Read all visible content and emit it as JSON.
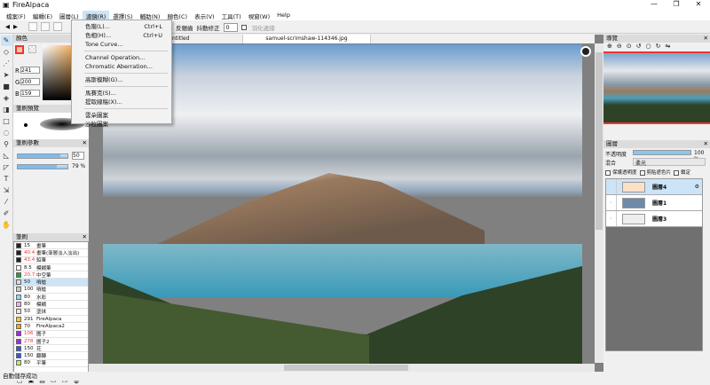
{
  "app": {
    "title": "FireAlpaca",
    "minimize": "—",
    "maximize": "❐",
    "close": "✕"
  },
  "menubar": [
    "檔案(F)",
    "編輯(E)",
    "圖層(L)",
    "濾鏡(R)",
    "選擇(S)",
    "輔助(N)",
    "顏色(C)",
    "表示(V)",
    "工具(T)",
    "視窗(W)",
    "Help"
  ],
  "toolbar": {
    "antialias": "反鋸齒",
    "stabilizer_label": "抖動修正",
    "stabilizer_value": "0",
    "feather": "羽化邊緣"
  },
  "filter_menu": {
    "items": [
      {
        "label": "色階(L)...",
        "shortcut": "Ctrl+L"
      },
      {
        "label": "色相(H)...",
        "shortcut": "Ctrl+U"
      },
      {
        "label": "Tone Curve...",
        "shortcut": ""
      },
      {
        "label": "Channel Operation...",
        "shortcut": ""
      },
      {
        "label": "Chromatic Aberration...",
        "shortcut": ""
      },
      {
        "label": "高斯模糊(G)...",
        "shortcut": ""
      },
      {
        "label": "馬賽克(S)...",
        "shortcut": ""
      },
      {
        "label": "提取線稿(X)...",
        "shortcut": ""
      },
      {
        "label": "雲朵圖案",
        "shortcut": ""
      },
      {
        "label": "沙粒圖案",
        "shortcut": ""
      }
    ]
  },
  "color_panel": {
    "title": "顏色",
    "r_label": "R",
    "r": "241",
    "g_label": "G",
    "g": "200",
    "b_label": "B",
    "b": "159",
    "fg": "#f1c89f"
  },
  "brush_preview": {
    "title": "筆刷預覽"
  },
  "brush_params": {
    "title": "筆刷參數",
    "size": "50",
    "opacity": "79 %",
    "size_fraction": 0.85,
    "opacity_fraction": 0.79
  },
  "brushes": {
    "title": "筆刷",
    "items": [
      {
        "size": "15",
        "name": "畫筆",
        "color": "#222222",
        "red": false
      },
      {
        "size": "40.4",
        "name": "畫筆(漸層淡入淡出)",
        "color": "#222222",
        "red": true
      },
      {
        "size": "43.4",
        "name": "鉛筆",
        "color": "#222222",
        "red": true
      },
      {
        "size": "8.5",
        "name": "模糊筆",
        "color": "#ffffff",
        "red": false
      },
      {
        "size": "20.7",
        "name": "中空筆",
        "color": "#22aa22",
        "red": true
      },
      {
        "size": "50",
        "name": "噴槍",
        "color": "#dddddd",
        "red": false,
        "selected": true
      },
      {
        "size": "100",
        "name": "噴槍",
        "color": "#cccccc",
        "red": false
      },
      {
        "size": "80",
        "name": "水彩",
        "color": "#88ddff",
        "red": false
      },
      {
        "size": "80",
        "name": "模糊",
        "color": "#ffaaee",
        "red": false
      },
      {
        "size": "50",
        "name": "塗抹",
        "color": "#ffe0c8",
        "red": false
      },
      {
        "size": "291",
        "name": "FireAlpaca",
        "color": "#eecc22",
        "red": false
      },
      {
        "size": "70",
        "name": "FireAlpaca2",
        "color": "#ffaa00",
        "red": false
      },
      {
        "size": "106",
        "name": "圖子",
        "color": "#aa22ee",
        "red": true
      },
      {
        "size": "278",
        "name": "圖子2",
        "color": "#aa22ee",
        "red": true
      },
      {
        "size": "150",
        "name": "花",
        "color": "#3355ee",
        "red": false
      },
      {
        "size": "150",
        "name": "翻轉",
        "color": "#3355ee",
        "red": false
      },
      {
        "size": "80",
        "name": "平筆",
        "color": "#bbee66",
        "red": false
      }
    ]
  },
  "tabs": [
    {
      "label": "Untitled",
      "active": false
    },
    {
      "label": "samuel-scrimshaw-114346.jpg",
      "active": true
    }
  ],
  "navigator": {
    "title": "導覽"
  },
  "layers": {
    "title": "圖層",
    "opacity_label": "不透明度",
    "opacity": "100 %",
    "blend_label": "混合",
    "blend": "柔光",
    "protect": "保護透明度",
    "clip": "剪貼遮色片",
    "lock": "鎖定",
    "items": [
      {
        "name": "圖層4",
        "selected": true,
        "thumb": "#fbe0c8"
      },
      {
        "name": "圖層1",
        "selected": false,
        "thumb": "#6d8aa8"
      },
      {
        "name": "圖層3",
        "selected": false,
        "thumb": "#eeeeee"
      }
    ]
  },
  "status": "自動儲存成功"
}
